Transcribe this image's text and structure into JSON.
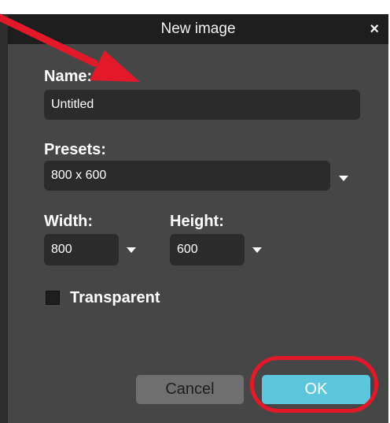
{
  "dialog": {
    "title": "New image",
    "close_symbol": "×",
    "name_label": "Name:",
    "name_value": "Untitled",
    "presets_label": "Presets:",
    "presets_value": "800 x 600",
    "width_label": "Width:",
    "width_value": "800",
    "height_label": "Height:",
    "height_value": "600",
    "transparent_label": "Transparent",
    "transparent_checked": false,
    "cancel_label": "Cancel",
    "ok_label": "OK"
  },
  "icons": {
    "close": "close-icon",
    "caret": "chevron-down-icon",
    "arrow": "red-arrow-annotation",
    "ring": "red-circle-annotation"
  },
  "colors": {
    "dialog_bg": "#464646",
    "titlebar_bg": "#1e1e1e",
    "field_bg": "#2b2b2b",
    "ok_bg": "#5ec6dc",
    "cancel_bg": "#6f6f6f",
    "annotation_red": "#e3192a"
  }
}
